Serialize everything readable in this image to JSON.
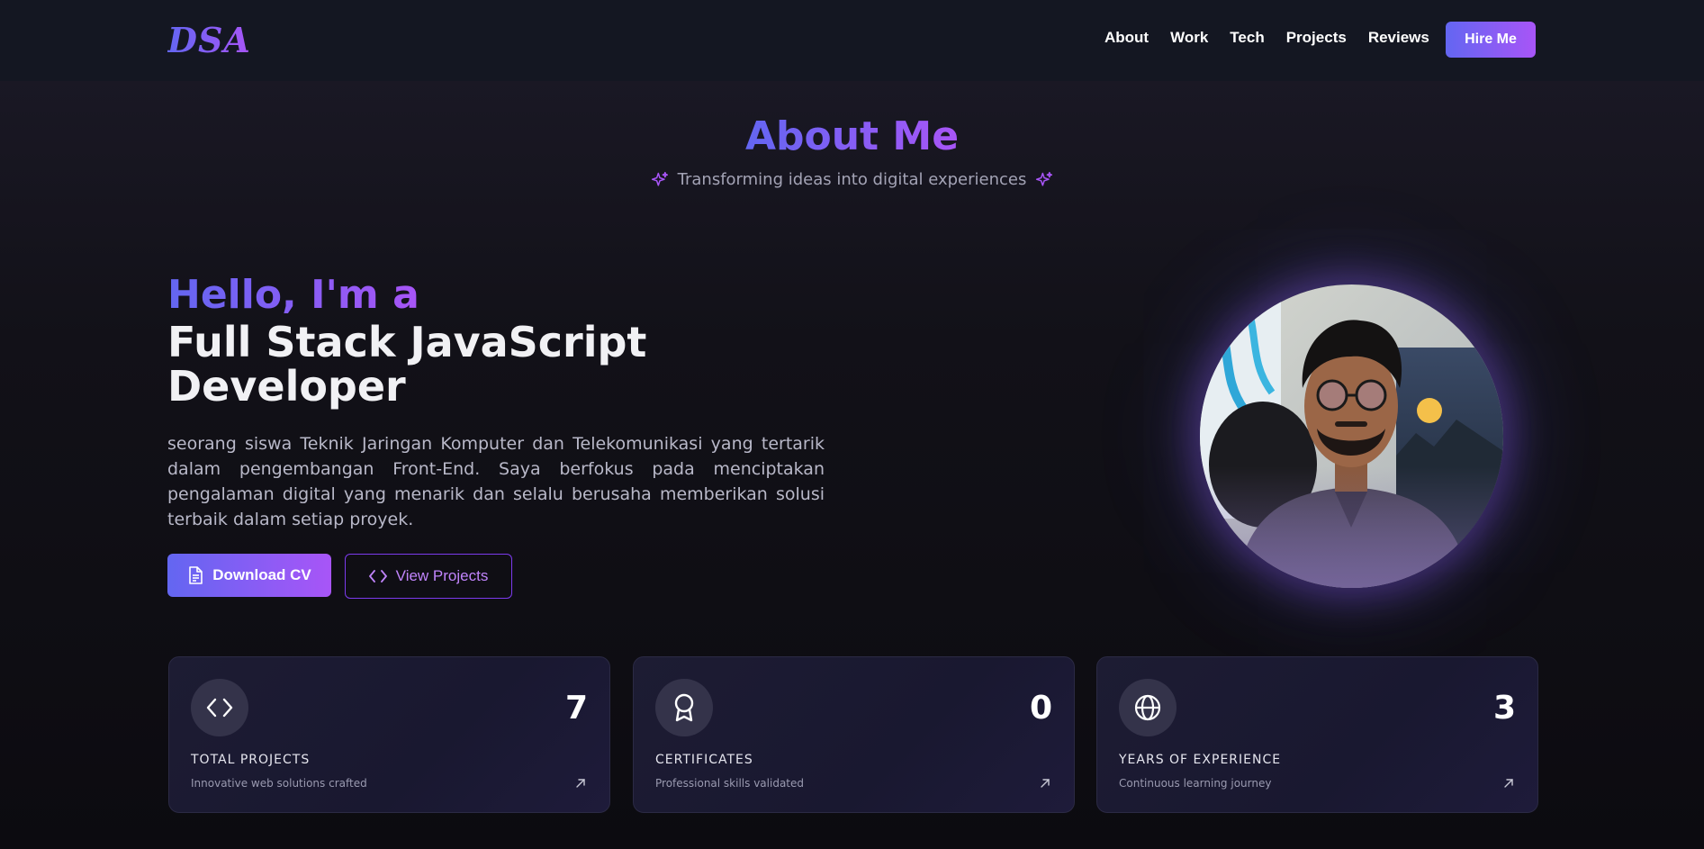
{
  "nav": {
    "logo": "DSA",
    "links": [
      "About",
      "Work",
      "Tech",
      "Projects",
      "Reviews"
    ],
    "cta": "Hire Me"
  },
  "section": {
    "title": "About Me",
    "subtitle": "Transforming ideas into digital experiences"
  },
  "hero": {
    "greeting": "Hello, I'm a",
    "role": "Full Stack JavaScript Developer",
    "bio": "seorang siswa Teknik Jaringan Komputer dan Telekomunikasi yang tertarik dalam pengembangan Front-End. Saya berfokus pada menciptakan pengalaman digital yang menarik dan selalu berusaha memberikan solusi terbaik dalam setiap proyek.",
    "download_cv": "Download CV",
    "view_projects": "View Projects"
  },
  "stats": [
    {
      "icon": "code-icon",
      "value": "7",
      "label": "TOTAL PROJECTS",
      "desc": "Innovative web solutions crafted"
    },
    {
      "icon": "award-icon",
      "value": "0",
      "label": "CERTIFICATES",
      "desc": "Professional skills validated"
    },
    {
      "icon": "globe-icon",
      "value": "3",
      "label": "YEARS OF EXPERIENCE",
      "desc": "Continuous learning journey"
    }
  ],
  "colors": {
    "accent_start": "#6366f1",
    "accent_end": "#a855f7",
    "nav_bg": "#141722",
    "card_bg": "#1d1c33"
  }
}
